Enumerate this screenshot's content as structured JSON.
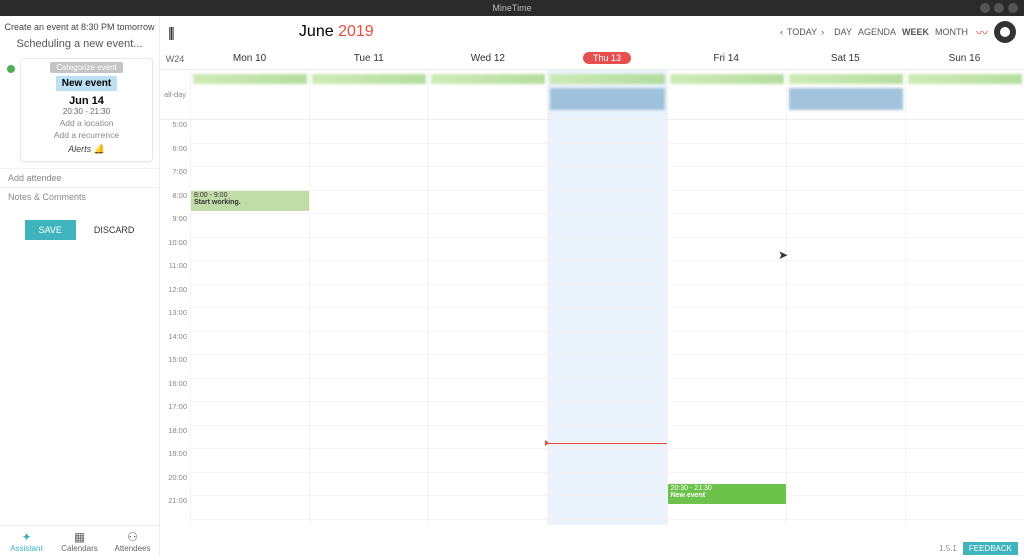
{
  "window": {
    "title": "MineTime"
  },
  "header": {
    "month": "June",
    "year": "2019",
    "today_label": "TODAY",
    "views": {
      "day": "DAY",
      "agenda": "AGENDA",
      "week": "WEEK",
      "month": "MONTH",
      "active": "WEEK"
    }
  },
  "sidebar": {
    "hint": "Create an event at 8:30 PM tomorrow",
    "scheduling": "Scheduling a new event...",
    "categorize": "Categorize event",
    "event": {
      "title": "New event",
      "date": "Jun 14",
      "time": "20:30 - 21:30",
      "location": "Add a location",
      "recurrence": "Add a recurrence",
      "alerts": "Alerts"
    },
    "add_attendee": "Add attendee",
    "notes": "Notes & Comments",
    "save": "SAVE",
    "discard": "DISCARD",
    "tabs": {
      "assistant": "Assistant",
      "calendars": "Calendars",
      "attendees": "Attendees"
    }
  },
  "calendar": {
    "week_label": "W24",
    "allday_label": "all-day",
    "days": [
      "Mon 10",
      "Tue 11",
      "Wed 12",
      "Thu 13",
      "Fri 14",
      "Sat 15",
      "Sun 16"
    ],
    "today_index": 3,
    "hours": [
      "5:00",
      "6:00",
      "7:00",
      "8:00",
      "9:00",
      "10:00",
      "11:00",
      "12:00",
      "13:00",
      "14:00",
      "15:00",
      "16:00",
      "17:00",
      "18:00",
      "19:00",
      "20:00",
      "21:00"
    ],
    "events": [
      {
        "day": 0,
        "label_time": "8:00 - 9:00",
        "label_title": "Start working."
      },
      {
        "day": 4,
        "label_time": "20:30 - 21:30",
        "label_title": "New event"
      }
    ]
  },
  "footer": {
    "version": "1.5.1",
    "feedback": "FEEDBACK"
  }
}
